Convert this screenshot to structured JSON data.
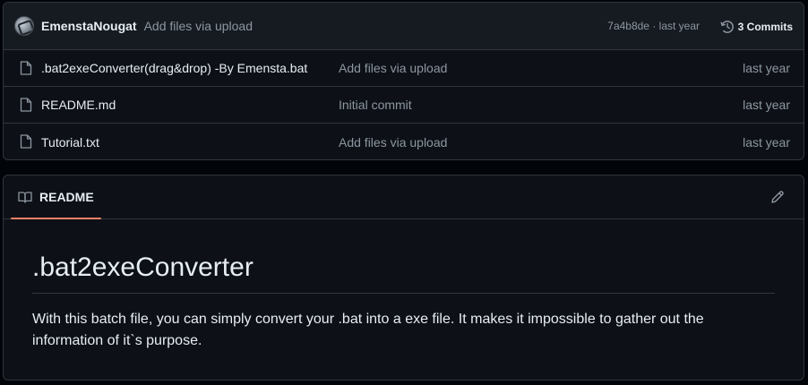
{
  "latest_commit": {
    "author": "EmenstaNougat",
    "message": "Add files via upload",
    "meta": "7a4b8de · last year",
    "commits_label": "3 Commits"
  },
  "files": [
    {
      "name": ".bat2exeConverter(drag&drop) -By Emensta.bat",
      "commit": "Add files via upload",
      "date": "last year"
    },
    {
      "name": "README.md",
      "commit": "Initial commit",
      "date": "last year"
    },
    {
      "name": "Tutorial.txt",
      "commit": "Add files via upload",
      "date": "last year"
    }
  ],
  "readme": {
    "tab_label": "README",
    "title": ".bat2exeConverter",
    "body": "With this batch file, you can simply convert your .bat into a exe file. It makes it impossible to gather out the information of it`s purpose."
  },
  "colors": {
    "accent_underline": "#f78166",
    "background": "#0d1117",
    "border": "#30363d",
    "muted_text": "#8d96a0"
  },
  "icons": {
    "avatar": "avatar",
    "history": "history-icon",
    "file": "file-icon",
    "book": "book-icon",
    "edit": "pencil-icon"
  }
}
